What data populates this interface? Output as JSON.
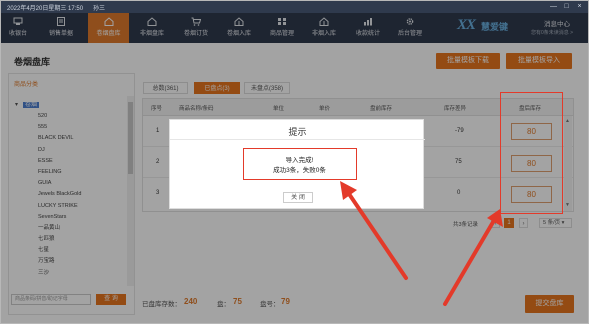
{
  "titlebar": {
    "datetime": "2022年4月20日星期三 17:50",
    "user": "孙三",
    "minimize": "—",
    "maximize": "□",
    "close": "×"
  },
  "nav": {
    "items": [
      {
        "label": "收银台",
        "icon": "cashier-icon"
      },
      {
        "label": "销售单据",
        "icon": "receipt-icon"
      },
      {
        "label": "卷烟盘库",
        "icon": "house-icon"
      },
      {
        "label": "非烟盘库",
        "icon": "house-icon"
      },
      {
        "label": "卷烟订货",
        "icon": "cart-icon"
      },
      {
        "label": "卷烟入库",
        "icon": "inbound-icon"
      },
      {
        "label": "商品管理",
        "icon": "goods-icon"
      },
      {
        "label": "非烟入库",
        "icon": "inbound-icon"
      },
      {
        "label": "收款统计",
        "icon": "chart-icon"
      },
      {
        "label": "后台管理",
        "icon": "gear-icon"
      }
    ],
    "active_index": 2,
    "logo_mark": "XX",
    "logo_text": "慧爱键",
    "message_center": "消息中心",
    "message_sub": "您有0条未读消息 >"
  },
  "page": {
    "title": "卷烟盘库",
    "batch_download": "批量模板下载",
    "batch_import": "批量模板导入"
  },
  "sidebar": {
    "title": "商品分类",
    "root_label": "卷烟",
    "items": [
      "520",
      "555",
      "BLACK DEVIL",
      "DJ",
      "ESSE",
      "FEELING",
      "GUIA",
      "Jewels BlackGold",
      "LUCKY STRIKE",
      "SevenStars",
      "一品黄山",
      "七匹狼",
      "七星",
      "万宝路",
      "三沙"
    ],
    "search_placeholder": "商品条码/拼音/助记字母",
    "search_button": "查 询"
  },
  "tabs": [
    {
      "label": "总数(361)"
    },
    {
      "label": "已盘点(3)"
    },
    {
      "label": "未盘点(358)"
    }
  ],
  "table": {
    "columns": [
      "序号",
      "商品名称/条码",
      "单位",
      "单价",
      "盘前库存",
      "库存差异",
      "盘后库存"
    ],
    "rows": [
      {
        "index": "1",
        "diff": "-79",
        "after": "80"
      },
      {
        "index": "2",
        "diff": "75",
        "after": "80"
      },
      {
        "index": "3",
        "diff": "0",
        "after": "80"
      }
    ],
    "scroll_up": "▲",
    "scroll_down": "▼"
  },
  "pager": {
    "total_text": "共3条记录",
    "prev": "‹",
    "current": "1",
    "next": "›",
    "page_size": "5 条/页 ▾"
  },
  "footer": {
    "total_label": "已盘库存数：",
    "total_value": "240",
    "box_label": "盘：",
    "box_value": "75",
    "tiao_label": "盘号：",
    "tiao_value": "79",
    "submit": "提交盘库"
  },
  "modal": {
    "title": "提示",
    "line1": "导入完成!",
    "line2": "成功3条，失败0条",
    "close": "关 闭"
  },
  "colors": {
    "nav_bg": "#2f3a4d",
    "accent": "#e8761f",
    "highlight": "#e33a2a"
  }
}
